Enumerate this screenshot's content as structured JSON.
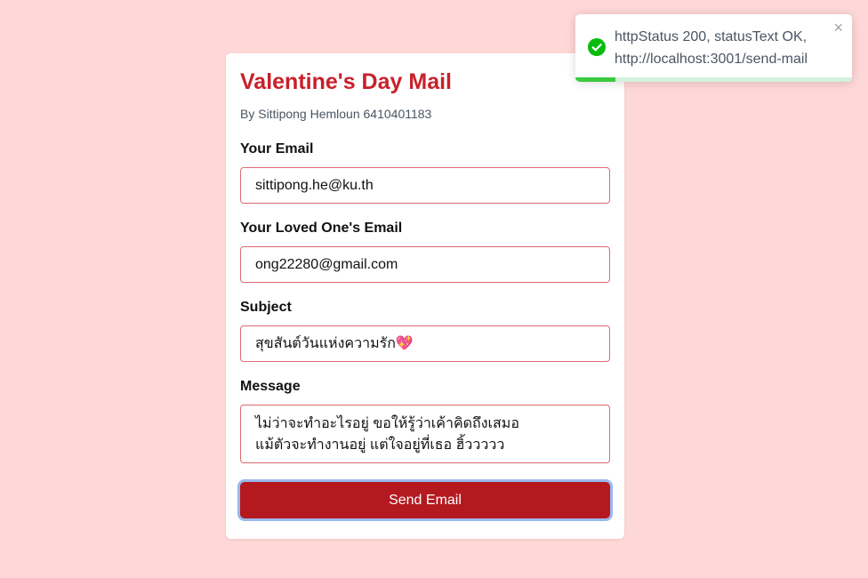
{
  "form": {
    "title": "Valentine's Day Mail",
    "byline": "By Sittipong Hemloun 6410401183",
    "email_label": "Your Email",
    "email_value": "sittipong.he@ku.th",
    "loved_label": "Your Loved One's Email",
    "loved_value": "ong22280@gmail.com",
    "subject_label": "Subject",
    "subject_value": "สุขสันต์วันแห่งความรัก💖",
    "message_label": "Message",
    "message_value": "ไม่ว่าจะทำอะไรอยู่ ขอให้รู้ว่าเค้าคิดถึงเสมอ\nแม้ตัวจะทำงานอยู่ แต่ใจอยู่ที่เธอ ฮิ้ววววว",
    "send_label": "Send Email"
  },
  "toast": {
    "line1": "httpStatus 200, statusText OK,",
    "line2": "http://localhost:3001/send-mail",
    "close_glyph": "×",
    "icon": "check-circle-icon",
    "progress": 0.145
  },
  "colors": {
    "page_background": "#fed7d7",
    "title": "#c8202a",
    "button": "#b4191f",
    "input_border": "#dc6a70",
    "success": "#07bc0c"
  }
}
